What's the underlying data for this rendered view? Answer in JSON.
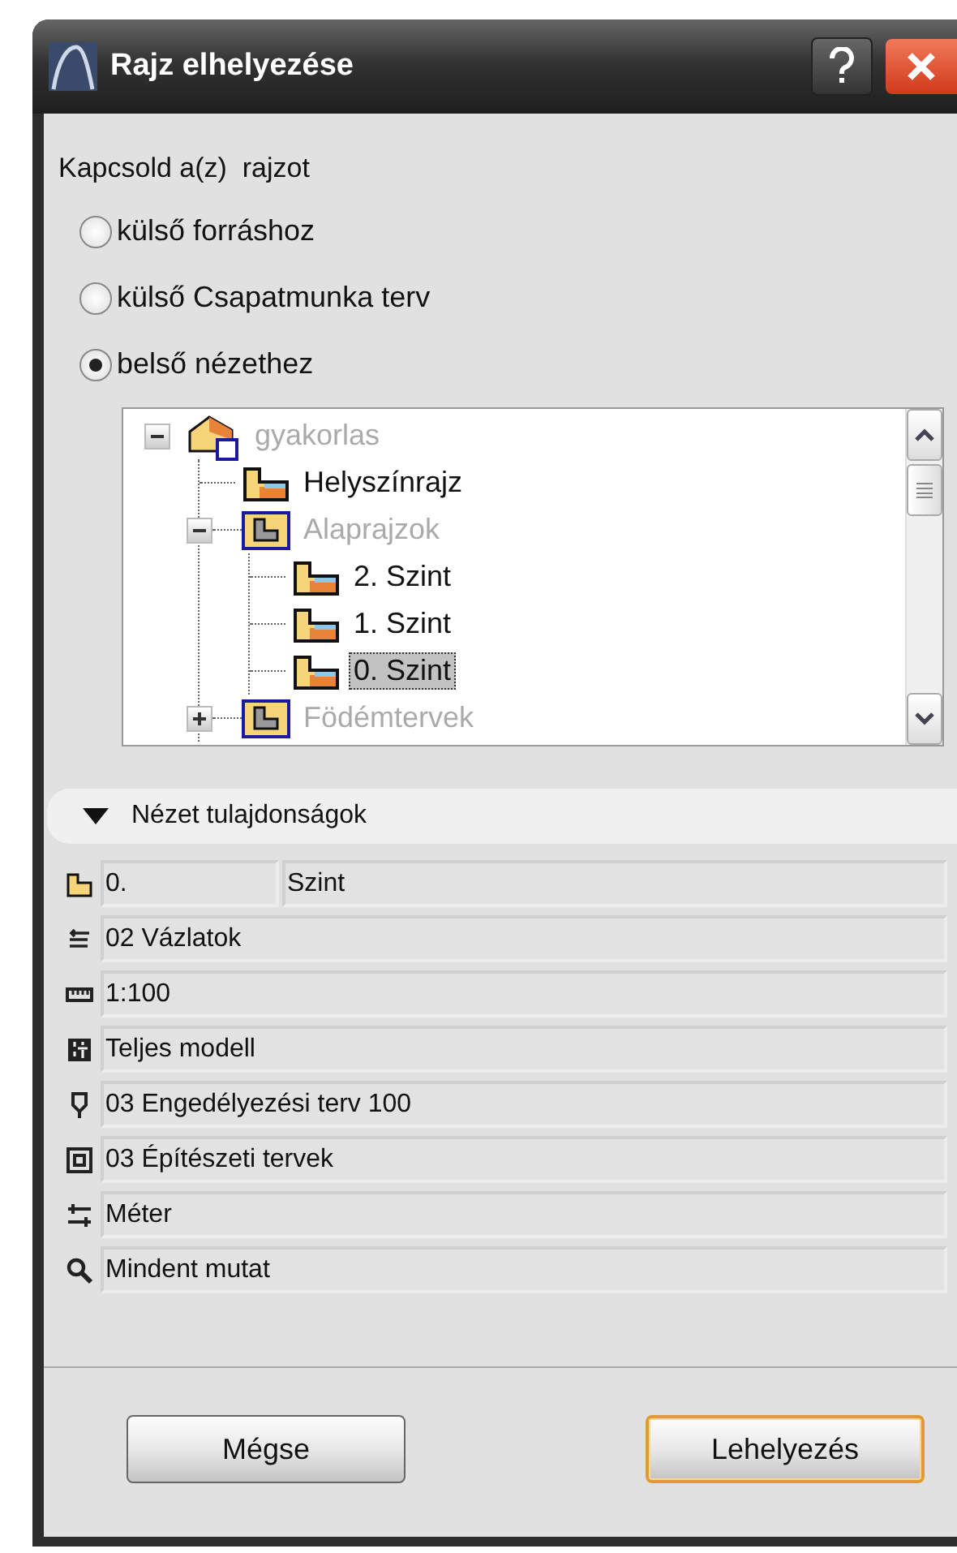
{
  "window": {
    "title": "Rajz elhelyezése"
  },
  "prompt": "Kapcsold a(z)  rajzot",
  "options": [
    {
      "label": "külső forráshoz",
      "selected": false
    },
    {
      "label": "külső Csapatmunka terv",
      "selected": false
    },
    {
      "label": "belső nézethez",
      "selected": true
    }
  ],
  "tree": {
    "items": [
      {
        "label": "gyakorlas",
        "kind": "project",
        "disabled": true,
        "selected": false,
        "expanded": true,
        "children": [
          {
            "label": "Helyszínrajz",
            "kind": "story",
            "disabled": false,
            "selected": false
          },
          {
            "label": "Alaprajzok",
            "kind": "folder",
            "disabled": true,
            "selected": false,
            "expanded": true,
            "children": [
              {
                "label": "2. Szint",
                "kind": "story",
                "disabled": false,
                "selected": false
              },
              {
                "label": "1. Szint",
                "kind": "story",
                "disabled": false,
                "selected": false
              },
              {
                "label": "0. Szint",
                "kind": "story",
                "disabled": false,
                "selected": true
              }
            ]
          },
          {
            "label": "Födémtervek",
            "kind": "folder",
            "disabled": true,
            "selected": false,
            "expanded": false
          }
        ]
      }
    ]
  },
  "properties": {
    "title": "Nézet tulajdonságok",
    "expanded": true,
    "rows": [
      {
        "kind": "story",
        "values": [
          "0.",
          "Szint"
        ]
      },
      {
        "kind": "layers",
        "values": [
          "02 Vázlatok"
        ]
      },
      {
        "kind": "scale",
        "values": [
          "1:100"
        ]
      },
      {
        "kind": "model",
        "values": [
          "Teljes modell"
        ]
      },
      {
        "kind": "pen",
        "values": [
          "03 Engedélyezési terv 100"
        ]
      },
      {
        "kind": "structure",
        "values": [
          "03 Építészeti tervek"
        ]
      },
      {
        "kind": "dimension",
        "values": [
          "Méter"
        ]
      },
      {
        "kind": "zoom",
        "values": [
          "Mindent mutat"
        ]
      }
    ]
  },
  "buttons": [
    {
      "label": "Mégse",
      "default": false
    },
    {
      "label": "Lehelyezés",
      "default": true
    }
  ]
}
